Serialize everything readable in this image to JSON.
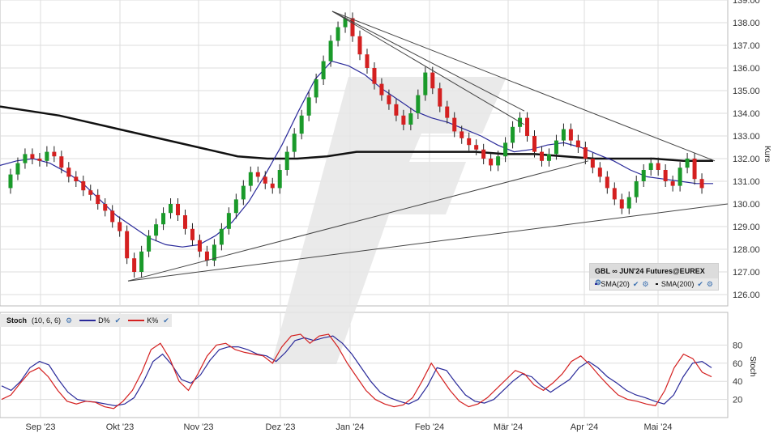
{
  "chart_data": [
    {
      "type": "candlestick",
      "instrument": "GBL ∞ JUN'24 Futures@EUREX",
      "ylabel": "Kurs",
      "ylim": [
        125.5,
        139.0
      ],
      "y_ticks": [
        "126.00",
        "127.00",
        "128.00",
        "129.00",
        "130.00",
        "131.00",
        "132.00",
        "133.00",
        "134.00",
        "135.00",
        "136.00",
        "137.00",
        "138.00",
        "139.00"
      ],
      "x_ticks": [
        "Sep '23",
        "Okt '23",
        "Nov '23",
        "Dez '23",
        "Jan '24",
        "Feb '24",
        "Mär '24",
        "Apr '24",
        "Mai '24"
      ],
      "grid": true,
      "legend_position": "bottom-right",
      "series": [
        {
          "name": "SMA(20)",
          "color": "#2a2a9a"
        },
        {
          "name": "SMA(200)",
          "color": "#111111"
        }
      ],
      "price_path": [
        130.7,
        131.3,
        131.8,
        132.2,
        132.0,
        131.9,
        132.3,
        132.1,
        131.6,
        131.2,
        131.0,
        130.6,
        130.4,
        130.0,
        129.7,
        129.2,
        128.8,
        127.6,
        127.0,
        127.9,
        128.6,
        129.1,
        129.6,
        130.0,
        129.5,
        128.9,
        128.4,
        127.9,
        127.5,
        128.2,
        128.9,
        129.6,
        130.2,
        130.8,
        131.4,
        131.2,
        130.9,
        130.7,
        131.5,
        132.3,
        133.1,
        133.9,
        134.7,
        135.5,
        136.3,
        137.2,
        137.8,
        138.2,
        137.4,
        136.6,
        136.0,
        135.3,
        134.8,
        134.4,
        133.9,
        133.5,
        134.0,
        134.8,
        135.8,
        135.1,
        134.3,
        133.8,
        133.2,
        132.9,
        132.6,
        132.4,
        132.0,
        131.7,
        132.1,
        132.7,
        133.4,
        133.8,
        133.0,
        132.3,
        131.9,
        132.2,
        132.8,
        133.3,
        132.8,
        132.5,
        132.0,
        131.6,
        131.2,
        130.7,
        130.2,
        129.8,
        130.3,
        131.0,
        131.5,
        131.8,
        131.5,
        131.0,
        130.8,
        131.6,
        132.0,
        131.1,
        130.7
      ],
      "sma20_path": [
        131.7,
        131.9,
        132.0,
        131.8,
        131.4,
        130.9,
        130.2,
        129.5,
        129.0,
        128.5,
        128.2,
        128.1,
        128.2,
        128.6,
        129.2,
        130.1,
        131.3,
        132.6,
        134.1,
        135.5,
        136.3,
        136.1,
        135.7,
        135.1,
        134.6,
        134.1,
        133.8,
        133.6,
        133.3,
        133.0,
        132.6,
        132.3,
        132.4,
        132.6,
        132.7,
        132.5,
        132.2,
        131.9,
        131.5,
        131.2,
        131.1,
        131.0,
        130.9,
        130.9
      ],
      "sma200_path": [
        134.3,
        134.1,
        133.9,
        133.6,
        133.3,
        133.0,
        132.7,
        132.4,
        132.1,
        132.0,
        132.0,
        132.1,
        132.3,
        132.3,
        132.3,
        132.3,
        132.3,
        132.2,
        132.2,
        132.1,
        132.0,
        132.0,
        132.0,
        131.9,
        131.9
      ],
      "trendlines": [
        {
          "from": [
            "Okt '23",
            126.6
          ],
          "to": [
            "May end",
            130.0
          ]
        },
        {
          "from": [
            "Okt '23",
            126.6
          ],
          "to": [
            "Apr '24",
            131.9
          ]
        },
        {
          "from": [
            "Jan '24",
            138.5
          ],
          "to": [
            "Mär '24",
            133.5
          ]
        },
        {
          "from": [
            "Jan '24",
            138.5
          ],
          "to": [
            "Mär '24",
            134.1
          ]
        },
        {
          "from": [
            "Jan '24",
            138.5
          ],
          "to": [
            "Mai '24",
            131.9
          ]
        }
      ]
    },
    {
      "type": "line",
      "title": "Stoch",
      "params": "(10, 6, 6)",
      "ylabel": "Stoch",
      "ylim": [
        0,
        100
      ],
      "y_ticks": [
        "20",
        "40",
        "60",
        "80"
      ],
      "series": [
        {
          "name": "D%",
          "color": "#2a2a9a",
          "values": [
            35,
            30,
            40,
            55,
            62,
            58,
            42,
            28,
            20,
            18,
            17,
            15,
            13,
            15,
            22,
            40,
            62,
            70,
            58,
            42,
            38,
            47,
            63,
            75,
            78,
            78,
            75,
            70,
            68,
            62,
            72,
            85,
            88,
            85,
            88,
            90,
            82,
            70,
            55,
            40,
            28,
            22,
            18,
            15,
            20,
            35,
            55,
            52,
            38,
            25,
            18,
            16,
            20,
            30,
            40,
            48,
            45,
            35,
            28,
            35,
            42,
            55,
            62,
            55,
            45,
            38,
            30,
            25,
            22,
            18,
            15,
            25,
            45,
            60,
            62,
            55
          ]
        },
        {
          "name": "K%",
          "color": "#d42020",
          "values": [
            20,
            25,
            38,
            50,
            55,
            45,
            30,
            18,
            15,
            18,
            17,
            12,
            10,
            18,
            30,
            50,
            75,
            82,
            65,
            40,
            30,
            48,
            68,
            80,
            82,
            75,
            72,
            70,
            68,
            60,
            78,
            90,
            92,
            82,
            90,
            92,
            78,
            60,
            45,
            30,
            20,
            15,
            12,
            14,
            22,
            40,
            60,
            45,
            30,
            18,
            12,
            15,
            22,
            32,
            42,
            52,
            48,
            36,
            30,
            38,
            48,
            62,
            68,
            58,
            46,
            35,
            25,
            20,
            18,
            15,
            13,
            30,
            55,
            70,
            65,
            50,
            45
          ]
        }
      ]
    }
  ]
}
